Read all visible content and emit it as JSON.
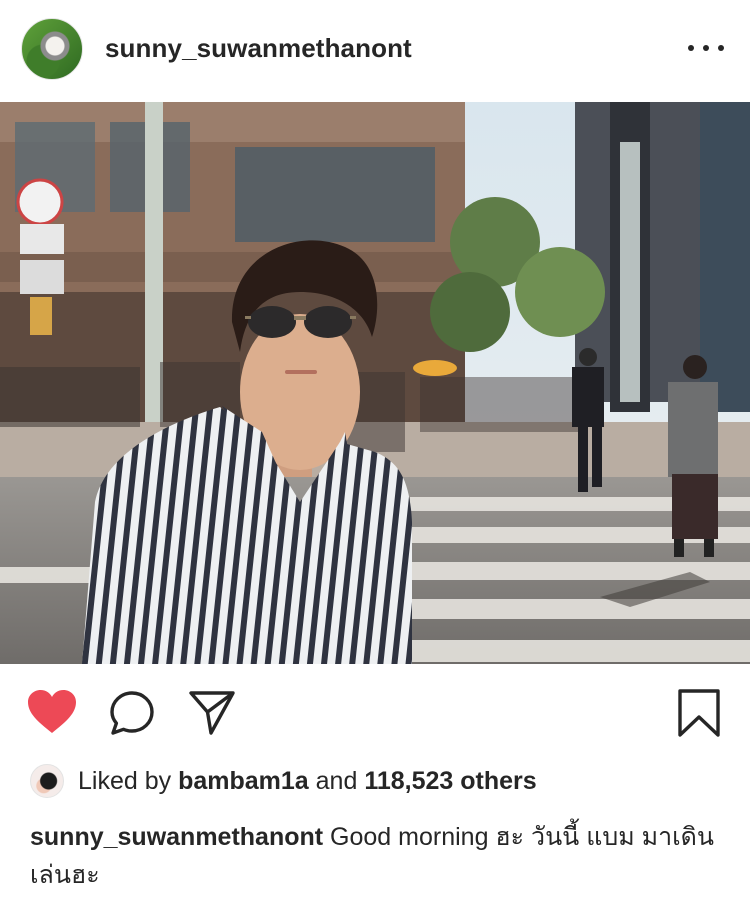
{
  "header": {
    "username": "sunny_suwanmethanont"
  },
  "actions": {
    "icons": [
      "heart-icon",
      "comment-icon",
      "share-icon",
      "bookmark-icon"
    ],
    "heart_color": "#ed4956"
  },
  "likes": {
    "prefix": "Liked by",
    "liker": "bambam1a",
    "connector": "and",
    "count": "118,523 others"
  },
  "caption": {
    "username": "sunny_suwanmethanont",
    "text": "Good morning ฮะ วันนี้ แบม มาเดินเล่นฮะ"
  }
}
